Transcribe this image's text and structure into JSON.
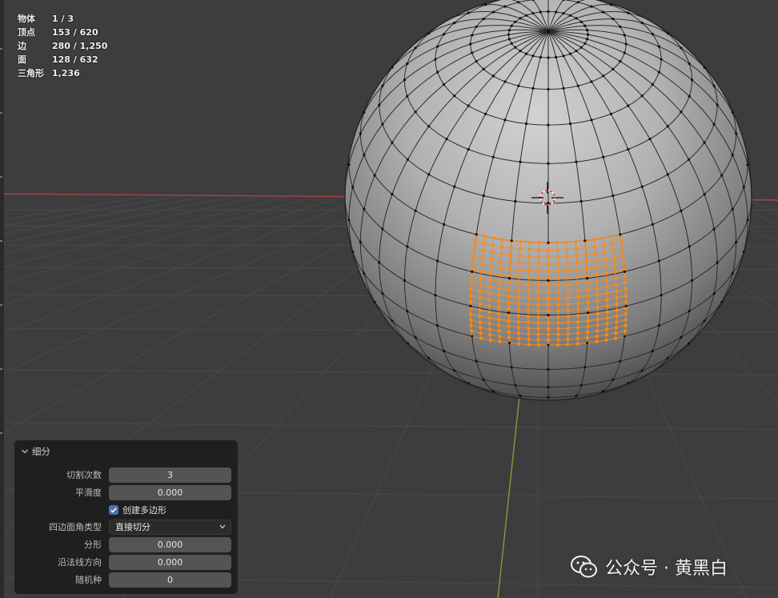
{
  "stats": [
    {
      "label": "物体",
      "value": "1 / 3"
    },
    {
      "label": "顶点",
      "value": "153 / 620"
    },
    {
      "label": "边",
      "value": "280 / 1,250"
    },
    {
      "label": "面",
      "value": "128 / 632"
    },
    {
      "label": "三角形",
      "value": "1,236"
    }
  ],
  "panel": {
    "title": "细分",
    "cuts_label": "切割次数",
    "cuts_value": "3",
    "smoothness_label": "平滑度",
    "smoothness_value": "0.000",
    "create_ngons_label": "创建多边形",
    "create_ngons_checked": true,
    "quad_corner_label": "四边面角类型",
    "quad_corner_value": "直接切分",
    "fractal_label": "分形",
    "fractal_value": "0.000",
    "along_normal_label": "沿法线方向",
    "along_normal_value": "0.000",
    "seed_label": "随机种",
    "seed_value": "0"
  },
  "watermark": {
    "text": "公众号 · 黄黑白"
  },
  "colors": {
    "background": "#3d3d3d",
    "panel": "#1f1f1f",
    "field": "#545454",
    "checkbox": "#4772b3",
    "selection": "#ff8a16",
    "x_axis": "#b5454a",
    "y_axis": "#7da23a"
  }
}
